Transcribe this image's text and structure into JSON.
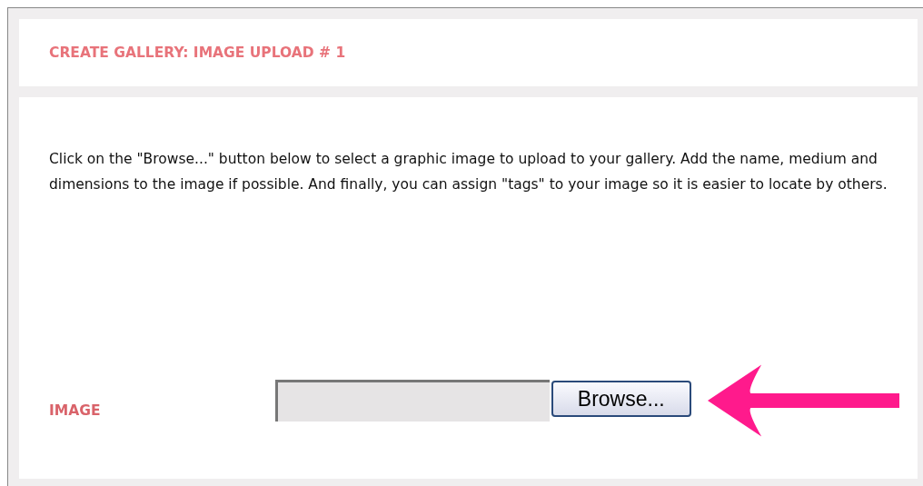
{
  "header": {
    "title": "CREATE GALLERY: IMAGE UPLOAD # 1"
  },
  "intro": "Click on the \"Browse...\" button below to select a graphic image to upload to your gallery. Add the name, medium and dimensions to the image if possible. And finally, you can assign \"tags\" to your image so it is easier to locate by others.",
  "image_field": {
    "label": "IMAGE",
    "button": "Browse..."
  }
}
